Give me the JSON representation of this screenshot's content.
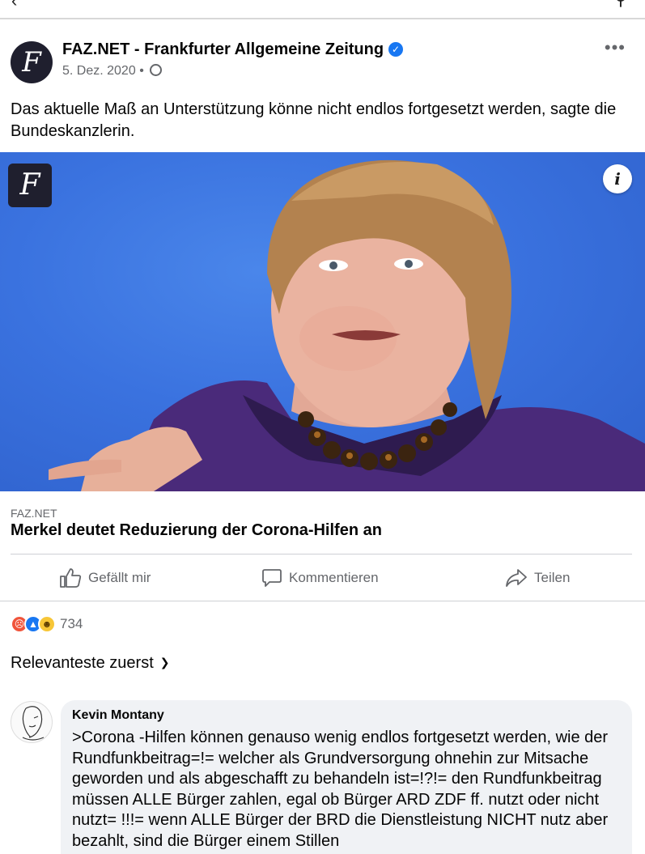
{
  "post": {
    "page_name": "FAZ.NET - Frankfurter Allgemeine Zeitung",
    "date": "5. Dez. 2020",
    "separator": "•",
    "text": "Das aktuelle Maß an Unterstützung könne nicht endlos fortgesetzt werden, sagte die Bundeskanzlerin.",
    "more_label": "•••"
  },
  "link": {
    "domain": "FAZ.NET",
    "title": "Merkel deutet Reduzierung der Corona-Hilfen an"
  },
  "actions": {
    "like": "Gefällt mir",
    "comment": "Kommentieren",
    "share": "Teilen"
  },
  "reactions": {
    "count": "734",
    "types": [
      "angry-icon",
      "like-icon",
      "haha-icon"
    ]
  },
  "sort": {
    "label": "Relevanteste zuerst"
  },
  "comment": {
    "author": "Kevin Montany",
    "text": ">Corona -Hilfen können genauso wenig endlos fortgesetzt werden, wie der Rundfunkbeitrag=!= welcher als Grundversorgung ohnehin zur Mitsache geworden und als abgeschafft zu behandeln ist=!?!= den Rundfunkbeitrag müssen ALLE Bürger zahlen, egal ob Bürger ARD ZDF ff. nutzt oder nicht nutzt= !!!= wenn ALLE Bürger der BRD die Dienstleistung NICHT nutz aber bezahlt, sind die Bürger einem Stillen"
  },
  "colors": {
    "accent": "#1877f2",
    "secondary_text": "#65676b",
    "photo_background": "#3a72df",
    "comment_bubble": "#f0f2f5"
  }
}
